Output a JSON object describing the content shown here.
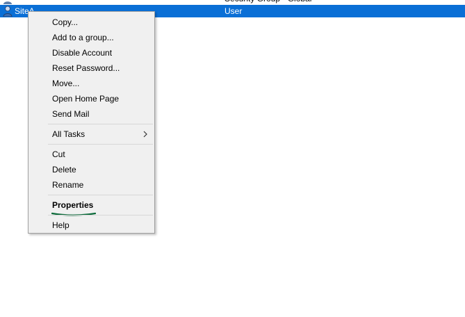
{
  "list": {
    "partial_row": {
      "name": "",
      "type": "Security Group - Global"
    },
    "selected_row": {
      "name": "SiteA",
      "type": "User",
      "icon": "user-icon"
    }
  },
  "context_menu": {
    "items": [
      {
        "label": "Copy..."
      },
      {
        "label": "Add to a group..."
      },
      {
        "label": "Disable Account"
      },
      {
        "label": "Reset Password..."
      },
      {
        "label": "Move..."
      },
      {
        "label": "Open Home Page"
      },
      {
        "label": "Send Mail"
      },
      {
        "label": "All Tasks",
        "submenu": true
      },
      {
        "label": "Cut"
      },
      {
        "label": "Delete"
      },
      {
        "label": "Rename"
      },
      {
        "label": "Properties",
        "default": true
      },
      {
        "label": "Help"
      }
    ]
  },
  "colors": {
    "selection": "#0a6fd6",
    "menu_background": "#f0f0f0",
    "annotation_underline": "#0b6b3a"
  }
}
